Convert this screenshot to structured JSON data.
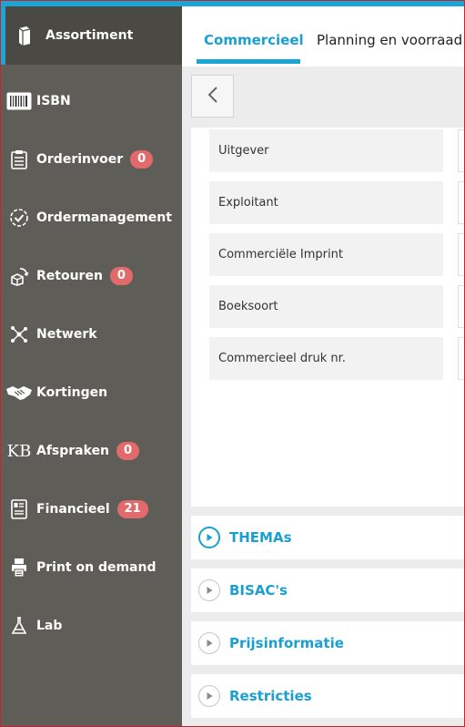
{
  "colors": {
    "accent": "#19a6d6",
    "sidebar_bg": "#5f5d57",
    "badge": "#e36a6a",
    "link": "#1a9fd0"
  },
  "sidebar": {
    "items": [
      {
        "label": "Assortiment",
        "icon": "books-icon",
        "active": true
      },
      {
        "label": "ISBN",
        "icon": "barcode-icon"
      },
      {
        "label": "Orderinvoer",
        "icon": "clipboard-icon",
        "badge": "0"
      },
      {
        "label": "Ordermanagement",
        "icon": "check-circle-icon"
      },
      {
        "label": "Retouren",
        "icon": "return-box-icon",
        "badge": "0"
      },
      {
        "label": "Netwerk",
        "icon": "network-icon"
      },
      {
        "label": "Kortingen",
        "icon": "handshake-icon"
      },
      {
        "label": "Afspraken",
        "icon": "kb-logo-icon",
        "badge": "0",
        "icon_text": "KB"
      },
      {
        "label": "Financieel",
        "icon": "invoice-icon",
        "badge": "21"
      },
      {
        "label": "Print on demand",
        "icon": "printer-icon"
      },
      {
        "label": "Lab",
        "icon": "flask-icon"
      }
    ]
  },
  "tabs": [
    {
      "label": "Commercieel",
      "active": true
    },
    {
      "label": "Planning en voorraad"
    }
  ],
  "fields": [
    {
      "label": "Uitgever"
    },
    {
      "label": "Exploitant"
    },
    {
      "label": "Commerciële Imprint"
    },
    {
      "label": "Boeksoort"
    },
    {
      "label": "Commercieel druk nr."
    }
  ],
  "sections": [
    {
      "label": "THEMAs",
      "state": "open"
    },
    {
      "label": "BISAC's",
      "state": "closed"
    },
    {
      "label": "Prijsinformatie",
      "state": "closed"
    },
    {
      "label": "Restricties",
      "state": "closed"
    }
  ]
}
